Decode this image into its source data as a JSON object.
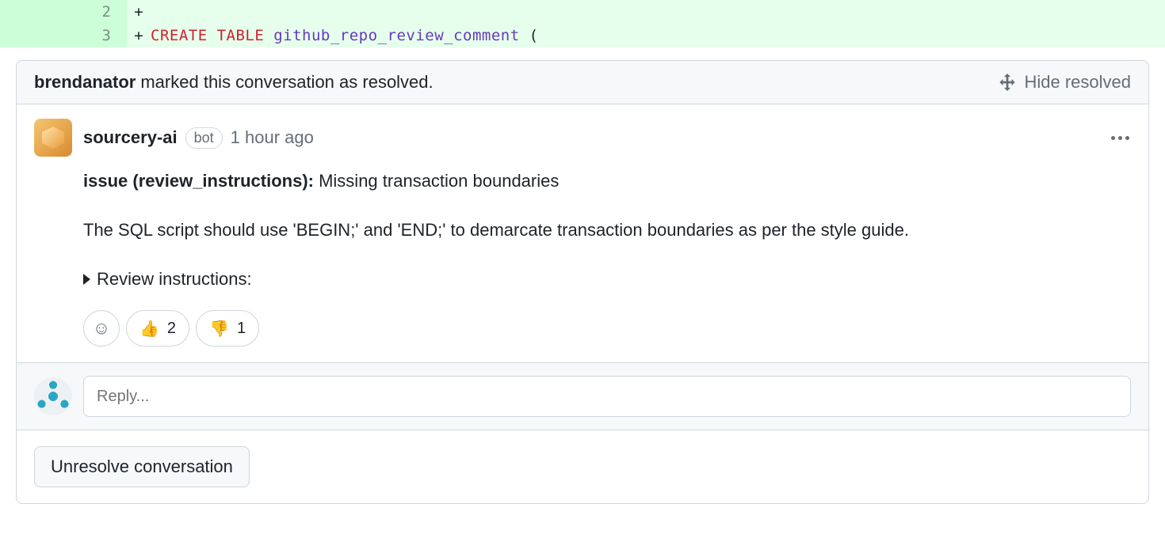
{
  "diff": {
    "rows": [
      {
        "num": "2",
        "marker": "+",
        "code_parts": []
      },
      {
        "num": "3",
        "marker": "+",
        "code_parts": [
          {
            "text": "CREATE TABLE",
            "class": "kw-red"
          },
          {
            "text": " ",
            "class": ""
          },
          {
            "text": "github_repo_review_comment",
            "class": "kw-purple"
          },
          {
            "text": " (",
            "class": ""
          }
        ]
      }
    ]
  },
  "thread": {
    "resolver": "brendanator",
    "resolved_text": " marked this conversation as resolved.",
    "hide_label": "Hide resolved"
  },
  "comment": {
    "author": "sourcery-ai",
    "bot_label": "bot",
    "timestamp": "1 hour ago",
    "issue_prefix": "issue (review_instructions):",
    "issue_title": " Missing transaction boundaries",
    "body_text": "The SQL script should use 'BEGIN;' and 'END;' to demarcate transaction boundaries as per the style guide.",
    "details_label": "Review instructions:"
  },
  "reactions": {
    "add_icon": "☺",
    "items": [
      {
        "emoji": "👍",
        "count": "2"
      },
      {
        "emoji": "👎",
        "count": "1"
      }
    ]
  },
  "reply": {
    "placeholder": "Reply..."
  },
  "footer": {
    "unresolve_label": "Unresolve conversation"
  }
}
